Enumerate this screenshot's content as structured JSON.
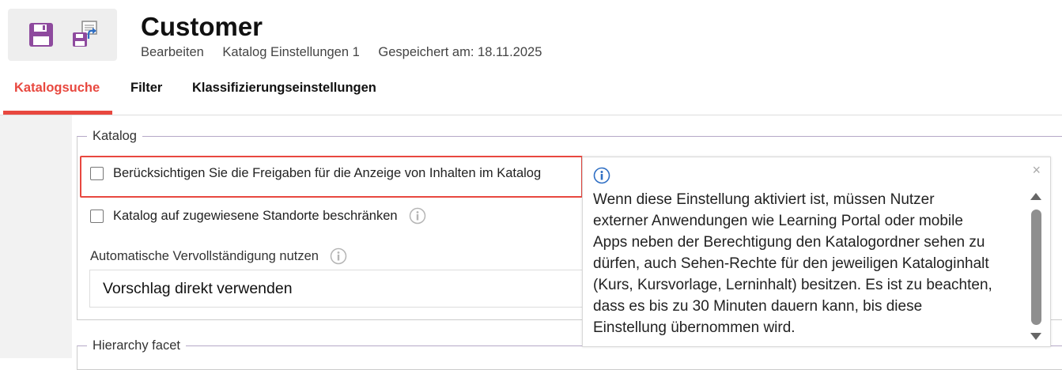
{
  "header": {
    "title": "Customer",
    "breadcrumb": [
      "Bearbeiten",
      "Katalog Einstellungen 1",
      "Gespeichert am: 18.11.2025"
    ],
    "toolbar": {
      "save_icon": "save-icon",
      "save_as_icon": "save-as-icon"
    }
  },
  "tabs": [
    {
      "label": "Katalogsuche",
      "active": true
    },
    {
      "label": "Filter",
      "active": false
    },
    {
      "label": "Klassifizierungseinstellungen",
      "active": false
    }
  ],
  "katalog": {
    "legend": "Katalog",
    "checkbox_freigaben": {
      "label": "Berücksichtigen Sie die Freigaben für die Anzeige von Inhalten im Katalog",
      "checked": false
    },
    "checkbox_standorte": {
      "label": "Katalog auf zugewiesene Standorte beschränken",
      "checked": false
    },
    "autocomplete": {
      "label": "Automatische Vervollständigung nutzen",
      "value": "Vorschlag direkt verwenden"
    }
  },
  "hierarchy": {
    "legend": "Hierarchy facet"
  },
  "tooltip": {
    "close": "×",
    "lines": [
      "Wenn diese Einstellung aktiviert ist, müssen Nutzer",
      "externer Anwendungen wie Learning Portal oder mobile",
      "Apps neben der Berechtigung den Katalogordner sehen zu",
      "dürfen, auch Sehen-Rechte für den jeweiligen Kataloginhalt",
      "(Kurs, Kursvorlage, Lerninhalt) besitzen. Es ist zu beachten,",
      "dass es bis zu 30 Minuten dauern kann, bis diese",
      "Einstellung übernommen wird."
    ]
  },
  "colors": {
    "accent": "#e8483f",
    "icon_purple": "#8e4a9e",
    "info_blue": "#2f6fc4"
  }
}
